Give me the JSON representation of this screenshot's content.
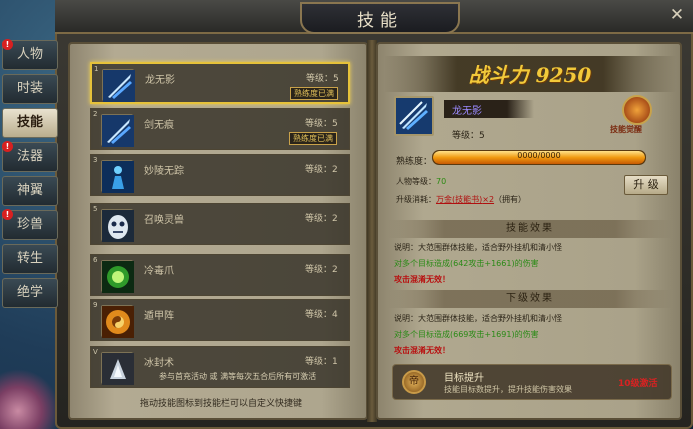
{
  "window": {
    "title": "技能",
    "close": "✕"
  },
  "tabs": [
    {
      "label": "人物",
      "alert": true
    },
    {
      "label": "时装",
      "alert": false
    },
    {
      "label": "技能",
      "alert": false,
      "active": true
    },
    {
      "label": "法器",
      "alert": true
    },
    {
      "label": "神翼",
      "alert": false
    },
    {
      "label": "珍兽",
      "alert": true
    },
    {
      "label": "转生",
      "alert": false
    },
    {
      "label": "绝学",
      "alert": false
    }
  ],
  "skills": [
    {
      "num": "1",
      "name": "龙无影",
      "level": "等级：5",
      "tag": "熟练度已满",
      "desc": "",
      "icon": "sword-icon",
      "selected": true
    },
    {
      "num": "2",
      "name": "剑无痕",
      "level": "等级：5",
      "tag": "熟练度已满",
      "desc": "",
      "icon": "sword-icon",
      "selected": false
    },
    {
      "num": "3",
      "name": "妙陵无踪",
      "level": "等级：2",
      "tag": "",
      "desc": "",
      "icon": "figure-icon",
      "selected": false
    },
    {
      "num": "5",
      "name": "召唤灵兽",
      "level": "等级：2",
      "tag": "",
      "desc": "",
      "icon": "beast-icon",
      "selected": false
    },
    {
      "num": "6",
      "name": "冷毒爪",
      "level": "等级：2",
      "tag": "",
      "desc": "",
      "icon": "poison-icon",
      "selected": false
    },
    {
      "num": "9",
      "name": "遁甲阵",
      "level": "等级：4",
      "tag": "",
      "desc": "",
      "icon": "bagua-icon",
      "selected": false
    },
    {
      "num": "V",
      "name": "冰封术",
      "level": "等级：1",
      "tag": "",
      "desc": "参与首充活动 或 满等每次五合后所有可激活",
      "icon": "ice-icon",
      "selected": false
    }
  ],
  "hint": "拖动技能图标到技能栏可以自定义快捷键",
  "detail": {
    "power_label": "战斗力",
    "power_value": "9250",
    "skill_name": "龙无影",
    "level": "等级：5",
    "awaken_label": "技能觉醒",
    "proficiency_label": "熟练度：",
    "proficiency_text": "0000/0000",
    "proficiency_fraction": 1.0,
    "role_level_label": "人物等级：",
    "role_level_value": "70",
    "cost_label": "升级消耗：",
    "cost_value": "万金(技能书)",
    "cost_count": "×2",
    "cost_owned": "（拥有）",
    "upgrade_button": "升 级",
    "effect_head": "技能效果",
    "effect_lines": [
      {
        "text": "说明：大范围群体技能，适合野外挂机和清小怪",
        "cls": ""
      },
      {
        "text": "对多个目标造成(642攻击+1661)的伤害",
        "cls": "green"
      },
      {
        "text": "攻击混淆无效！",
        "cls": "red"
      }
    ],
    "next_head": "下级效果",
    "next_lines": [
      {
        "text": "说明：大范围群体技能，适合野外挂机和清小怪",
        "cls": ""
      },
      {
        "text": "对多个目标造成(669攻击+1691)的伤害",
        "cls": "green"
      },
      {
        "text": "攻击混淆无效！",
        "cls": "red"
      }
    ],
    "target": {
      "icon": "帝",
      "title": "目标提升",
      "desc": "技能目标数提升，提升技能伤害效果",
      "req": "10级激活"
    }
  },
  "colors": {
    "accent": "#e6c23a",
    "power": "#f2c93a",
    "skill_name": "#9b8aff",
    "alert": "#d82020"
  }
}
